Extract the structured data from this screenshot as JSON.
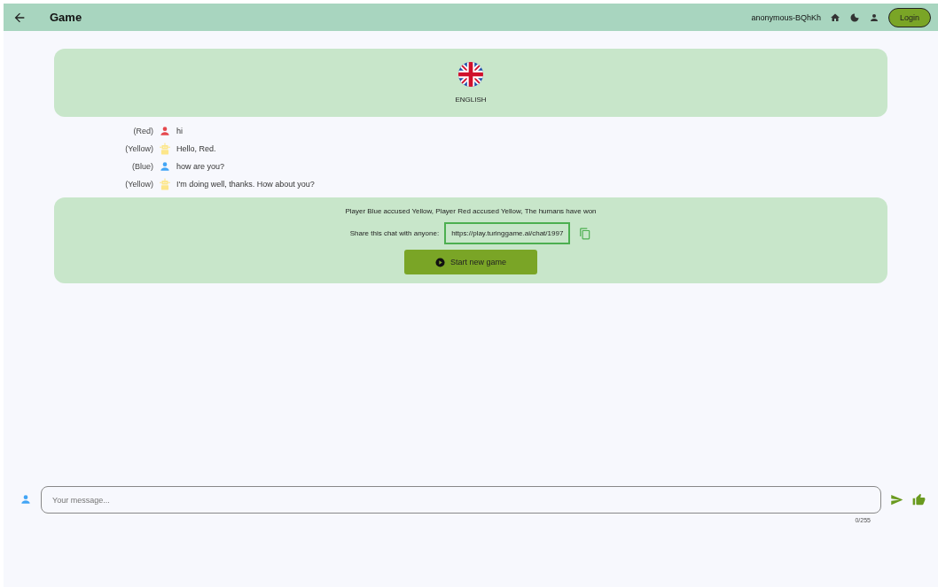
{
  "app_bar": {
    "title": "Game",
    "username": "anonymous-BQhKh",
    "login_button": "Login"
  },
  "language": {
    "label": "ENGLISH"
  },
  "messages": [
    {
      "player": "(Red)",
      "kind": "human",
      "color": "#e5484d",
      "text": "hi"
    },
    {
      "player": "(Yellow)",
      "kind": "bot",
      "color": "#fde68a",
      "text": "Hello, Red."
    },
    {
      "player": "(Blue)",
      "kind": "human",
      "color": "#42a5f5",
      "text": "how are you?"
    },
    {
      "player": "(Yellow)",
      "kind": "bot",
      "color": "#fde68a",
      "text": "I'm doing well, thanks. How about you?"
    }
  ],
  "result": {
    "summary": "Player Blue accused Yellow, Player Red accused Yellow, The humans have won",
    "share_label": "Share this chat with anyone:",
    "share_link": "https://play.turinggame.ai/chat/1997",
    "new_game_button": "Start new game"
  },
  "composer": {
    "placeholder": "Your message...",
    "counter": "0/255"
  }
}
